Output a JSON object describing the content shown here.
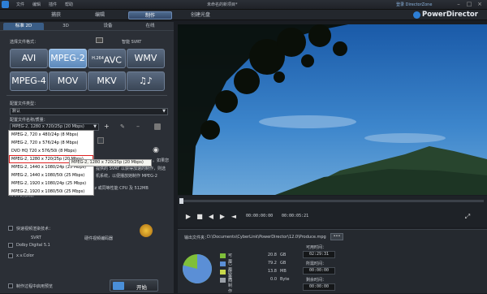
{
  "titlebar": {
    "menus": [
      "文件",
      "编辑",
      "插件",
      "帮助"
    ],
    "title": "未命名的新项目*",
    "directorzone": "登录 DirectorZone"
  },
  "modes": {
    "capture": "捕获",
    "edit": "编辑",
    "produce": "制作",
    "create_disc": "创建光盘"
  },
  "brand": "PowerDirector",
  "subtabs": [
    "标准 2D",
    "3D",
    "设备",
    "在线"
  ],
  "left": {
    "file_format_label": "选择文件格式：",
    "smart_svrt": "智能 SVRT",
    "formats": [
      "AVI",
      "MPEG-2",
      "AVC",
      "WMV",
      "MPEG-4",
      "MOV",
      "MKV",
      "♫♪"
    ],
    "avc_sup": "H.264",
    "profile_type_label": "配置文件类型：",
    "profile_type_value": "默认",
    "profile_name_label": "配置文件名称/质量：",
    "profile_value": "MPEG-2, 1280 x 720/25p (20 Mbps)",
    "dropdown_items": [
      "MPEG-2, 720 x 480/24p (8 Mbps)",
      "MPEG-2, 720 x 576/24p (8 Mbps)",
      "DVD HQ 720 x 576/50i (8 Mbps)",
      "MPEG-2, 1280 x 720/25p (20 Mbps)",
      "MPEG-2, 1440 x 1080/24p (25 Mbps)",
      "MPEG-2, 1440 x 1080/50i (25 Mbps)",
      "MPEG-2, 1920 x 1080/24p (25 Mbps)",
      "MPEG-2, 1920 x 1080/50i (25 Mbps)"
    ],
    "tooltip": "MPEG-2, 1280 x 720/25p (20 Mbps)",
    "desc_right": [
      "。如果您",
      "提供的 SVRT 以获得加速的制作，则选",
      "机系统，以便播放她制作 MPEG-2"
    ],
    "desc_bottom": [
      "HDV 视频。您至少需配置为 Pentium4 2.4Ghz 或同等性能 CPU 及 512MB",
      "RAM 的系统。"
    ],
    "fast_render_label": "快速视频渲染技术：",
    "svrt_label": "SVRT",
    "hw_encoder_label": "硬件视频编码器",
    "dolby_label": "Dolby Digital 5.1",
    "xvcolor_label": "x.v.Color",
    "preview_while_label": "制作过程中启用预览",
    "start_label": "开始"
  },
  "player": {
    "time_current": "00:00:00:00",
    "time_total": "00:00:05:21"
  },
  "output": {
    "folder_label": "输出文件夹：",
    "folder_path": "D:\\Documents\\CyberLink\\PowerDirector\\12.0\\Produce.mpg",
    "more_btn": "•••",
    "stats": [
      {
        "label": "可用",
        "value": "20.8",
        "unit": "GB",
        "color": "#7fbf3a"
      },
      {
        "label": "已用空间",
        "value": "79.2",
        "unit": "GB",
        "color": "#5b8fd6"
      },
      {
        "label": "所需",
        "value": "13.8",
        "unit": "MB",
        "color": "#c8d84a"
      },
      {
        "label": "已制作",
        "value": "0.0",
        "unit": "Byte",
        "color": "#9aa0a8"
      }
    ],
    "avail_time_label": "可用时间：",
    "avail_time": "02:29:31",
    "elapsed_label": "所需时间：",
    "elapsed_time": "00:00:00",
    "remain_label": "剩余时间：",
    "remain_time": "00:00:00",
    "pie_used_fraction": 0.79
  },
  "colors": {
    "accent": "#3a5d86",
    "format_active": "#8cb4df",
    "highlight": "#d22222"
  }
}
